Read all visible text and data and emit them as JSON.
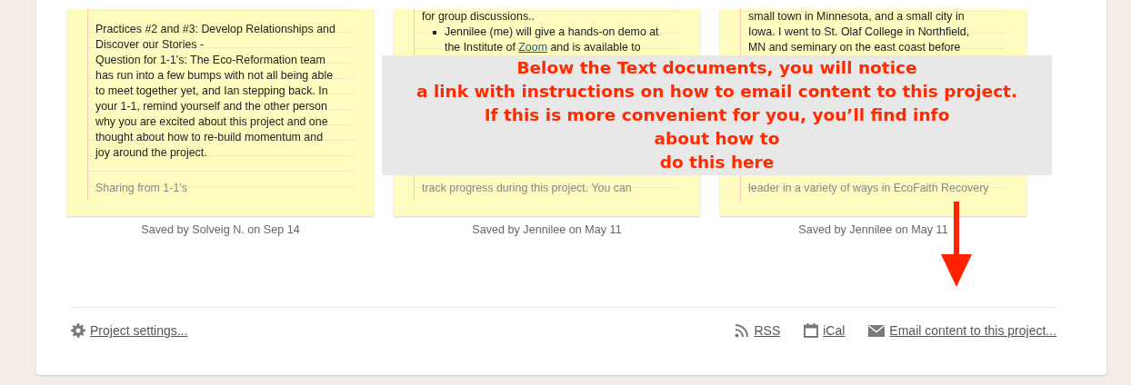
{
  "notes": [
    {
      "blocks": [
        {
          "kind": "text",
          "lines": [
            [
              {
                "kind": "text",
                "text": "Practices #2 and #3: Develop Relationships and"
              }
            ],
            [
              {
                "kind": "text",
                "text": "Discover our Stories -"
              }
            ],
            [
              {
                "kind": "text",
                "text": "Question for 1-1's: The Eco-Reformation team"
              }
            ],
            [
              {
                "kind": "text",
                "text": "has run into a few bumps with not all being able"
              }
            ],
            [
              {
                "kind": "text",
                "text": "to meet together yet, and Ian stepping back. In"
              }
            ],
            [
              {
                "kind": "text",
                "text": "your 1-1, remind yourself and the other person"
              }
            ],
            [
              {
                "kind": "text",
                "text": "why you are excited about this project and one"
              }
            ],
            [
              {
                "kind": "text",
                "text": "thought about how to re-build momentum and"
              }
            ],
            [
              {
                "kind": "text",
                "text": "joy around the project."
              }
            ]
          ]
        }
      ],
      "fade_line": "Sharing from 1-1's",
      "caption": "Saved by Solveig N. on Sep 14"
    },
    {
      "blocks": [
        {
          "kind": "text",
          "lines": [
            [
              {
                "kind": "text",
                "text": "for group discussions.."
              }
            ]
          ]
        },
        {
          "kind": "bullet",
          "lines": [
            [
              {
                "kind": "text",
                "text": "Jennilee (me) will give a hands-on demo at"
              }
            ],
            [
              {
                "kind": "text",
                "text": "the Institute of "
              },
              {
                "kind": "link",
                "text": "Zoom"
              },
              {
                "kind": "text",
                "text": " and is available to"
              }
            ]
          ]
        }
      ],
      "fade_line": "track progress during this project. You can",
      "caption": "Saved by Jennilee on May 11"
    },
    {
      "blocks": [
        {
          "kind": "text",
          "lines": [
            [
              {
                "kind": "text",
                "text": "small town in Minnesota, and a small city in"
              }
            ],
            [
              {
                "kind": "text",
                "text": "Iowa. I went to St. Olaf College in Northfield,"
              }
            ],
            [
              {
                "kind": "text",
                "text": "MN and seminary on the east coast before"
              }
            ]
          ]
        }
      ],
      "fade_line": "leader in a variety of ways in EcoFaith Recovery",
      "caption": "Saved by Jennilee on May 11"
    }
  ],
  "overlay": {
    "lines": [
      "Below the Text documents, you will notice",
      "a link with instructions on how to email content to this project.",
      "If this is more convenient for you, you’ll find info",
      "about how to",
      "do this here"
    ]
  },
  "footer": {
    "left": [
      {
        "kind": "settings",
        "label": "Project settings..."
      }
    ],
    "right": [
      {
        "kind": "rss",
        "label": "RSS"
      },
      {
        "kind": "calendar",
        "label": "iCal"
      },
      {
        "kind": "email",
        "label": "Email content to this project..."
      }
    ]
  }
}
